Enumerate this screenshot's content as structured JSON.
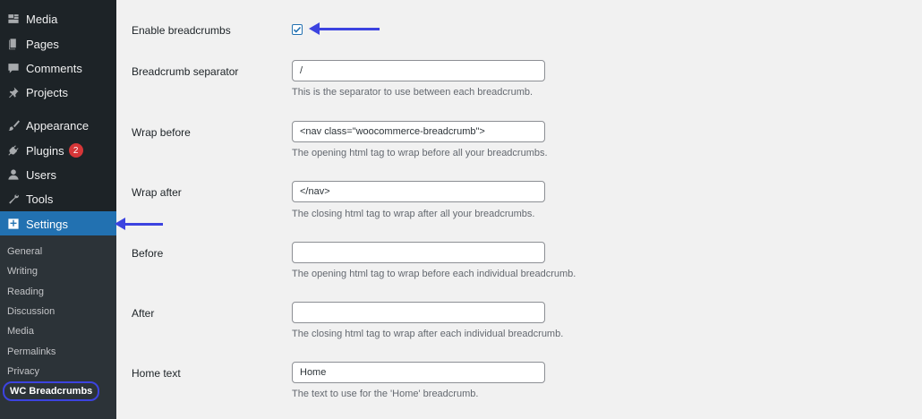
{
  "sidebar": {
    "items": [
      {
        "label": "Media",
        "icon": "media-icon"
      },
      {
        "label": "Pages",
        "icon": "pages-icon"
      },
      {
        "label": "Comments",
        "icon": "comments-icon"
      },
      {
        "label": "Projects",
        "icon": "pin-icon"
      },
      {
        "label": "Appearance",
        "icon": "brush-icon"
      },
      {
        "label": "Plugins",
        "icon": "plug-icon",
        "badge": "2"
      },
      {
        "label": "Users",
        "icon": "user-icon"
      },
      {
        "label": "Tools",
        "icon": "wrench-icon"
      },
      {
        "label": "Settings",
        "icon": "settings-icon"
      }
    ],
    "submenu": [
      "General",
      "Writing",
      "Reading",
      "Discussion",
      "Media",
      "Permalinks",
      "Privacy",
      "WC Breadcrumbs"
    ]
  },
  "settings": {
    "enable_breadcrumbs": {
      "label": "Enable breadcrumbs",
      "checked": true
    },
    "separator": {
      "label": "Breadcrumb separator",
      "value": "/",
      "desc": "This is the separator to use between each breadcrumb."
    },
    "wrap_before": {
      "label": "Wrap before",
      "value": "<nav class=\"woocommerce-breadcrumb\">",
      "desc": "The opening html tag to wrap before all your breadcrumbs."
    },
    "wrap_after": {
      "label": "Wrap after",
      "value": "</nav>",
      "desc": "The closing html tag to wrap after all your breadcrumbs."
    },
    "before": {
      "label": "Before",
      "value": "",
      "desc": "The opening html tag to wrap before each individual breadcrumb."
    },
    "after": {
      "label": "After",
      "value": "",
      "desc": "The closing html tag to wrap after each individual breadcrumb."
    },
    "home_text": {
      "label": "Home text",
      "value": "Home",
      "desc": "The text to use for the 'Home' breadcrumb."
    }
  },
  "colors": {
    "sidebar_bg": "#1d2327",
    "active_bg": "#2271b1",
    "annotation_arrow": "#3c43e0",
    "badge": "#d63638"
  }
}
